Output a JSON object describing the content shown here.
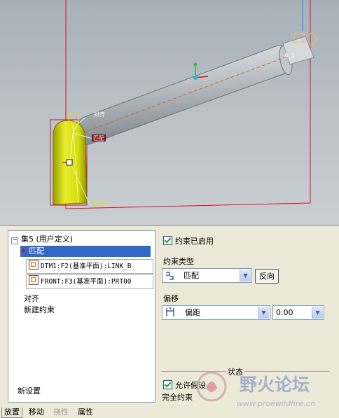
{
  "viewport": {
    "annot_match_upper": "对齐",
    "annot_match_lower": "匹配",
    "axis_label_end": "A_1",
    "offset_value": "0.00",
    "colors": {
      "frame": "#dd1020",
      "part": "#d8e01a",
      "shaft": "#c8ccd0"
    }
  },
  "tree": {
    "set_label": "集5 (用户定义)",
    "expand_icon": "minus-box-icon",
    "constraint_selected": "匹配",
    "refs": [
      "DTM1:F2(基准平面):LINK_B",
      "FRONT:F3(基准平面):PRT00"
    ],
    "align_item": "对齐",
    "new_constraint": "新建约束",
    "new_set": "新设置"
  },
  "settings": {
    "constraint_enabled_label": "约束已启用",
    "constraint_type_title": "约束类型",
    "constraint_type_value": "匹配",
    "reverse_button": "反向",
    "offset_title": "偏移",
    "offset_type_value": "偏距",
    "offset_value": "0.00",
    "status_title": "状态",
    "allow_assumption_label": "允许假设",
    "status_text": "完全约束"
  },
  "tabs": [
    {
      "label": "放置",
      "active": true,
      "enabled": true
    },
    {
      "label": "移动",
      "active": false,
      "enabled": true
    },
    {
      "label": "挠性",
      "active": false,
      "enabled": false
    },
    {
      "label": "属性",
      "active": false,
      "enabled": true
    }
  ],
  "watermark": {
    "title": "野火论坛",
    "url": "www.proewildfire.cn"
  }
}
